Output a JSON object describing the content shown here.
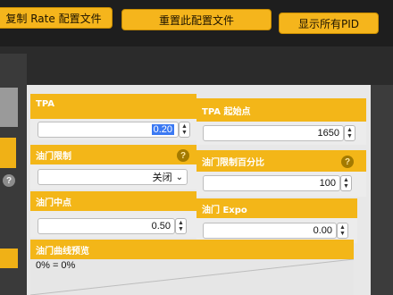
{
  "toolbar": {
    "copy_rate_profile": "复制 Rate 配置文件",
    "reset_profile": "重置此配置文件",
    "show_all_pids": "显示所有PID"
  },
  "tpa": {
    "label": "TPA",
    "value": "0.20"
  },
  "tpa_breakpoint": {
    "label": "TPA 起始点",
    "value": "1650"
  },
  "throttle_limit": {
    "label": "油门限制",
    "selected": "关闭"
  },
  "throttle_limit_percent": {
    "label": "油门限制百分比",
    "value": "100"
  },
  "throttle_mid": {
    "label": "油门中点",
    "value": "0.50"
  },
  "throttle_expo": {
    "label": "油门 Expo",
    "value": "0.00"
  },
  "throttle_curve": {
    "label": "油门曲线预览",
    "readout": "0% = 0%"
  },
  "icons": {
    "help": "?",
    "spin_up": "▲",
    "spin_down": "▼",
    "chevron": "⌄"
  }
}
